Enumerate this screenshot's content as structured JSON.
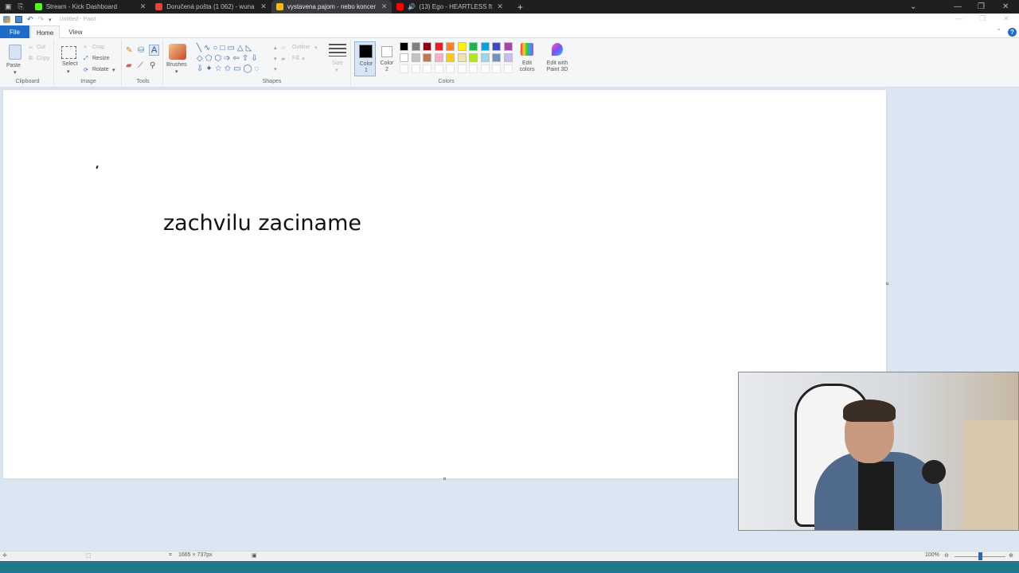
{
  "browser": {
    "tabs": [
      {
        "title": "Stream - Kick Dashboard",
        "favicon_color": "#53fc18"
      },
      {
        "title": "Doručená pošta (1 062) - wuna",
        "favicon_color": "#ea4335"
      },
      {
        "title": "vystavena pajom - nebo koncer",
        "favicon_color": "#fbbc04",
        "active": true
      },
      {
        "title": "(13) Ego - HEARTLESS ft. St",
        "favicon_color": "#ff0000"
      }
    ],
    "new_tab": "+"
  },
  "paint": {
    "title": "Untitled - Paint",
    "ribbon_tabs": {
      "file": "File",
      "home": "Home",
      "view": "View"
    },
    "clipboard": {
      "paste": "Paste",
      "cut": "Cut",
      "copy": "Copy",
      "group": "Clipboard"
    },
    "image": {
      "select": "Select",
      "crop": "Crop",
      "resize": "Resize",
      "rotate": "Rotate",
      "group": "Image"
    },
    "tools": {
      "group": "Tools",
      "brushes": "Brushes"
    },
    "shapes": {
      "group": "Shapes",
      "outline": "Outline",
      "fill": "Fill",
      "size": "Size"
    },
    "colors": {
      "group": "Colors",
      "color1": "Color 1",
      "color2": "Color 2",
      "edit_colors": "Edit colors",
      "edit_paint3d": "Edit with Paint 3D",
      "color1_value": "#000000",
      "color2_value": "#ffffff",
      "palette_row1": [
        "#000000",
        "#7f7f7f",
        "#880015",
        "#ed1c24",
        "#ff7f27",
        "#fff200",
        "#22b14c",
        "#00a2e8",
        "#3f48cc",
        "#a349a4"
      ],
      "palette_row2": [
        "#ffffff",
        "#c3c3c3",
        "#b97a57",
        "#ffaec9",
        "#ffc90e",
        "#efe4b0",
        "#b5e61d",
        "#99d9ea",
        "#7092be",
        "#c8bfe7"
      ]
    },
    "canvas_text": "zachvilu zaciname",
    "status": {
      "canvas_size": "1665 × 737px",
      "zoom": "100%"
    }
  }
}
